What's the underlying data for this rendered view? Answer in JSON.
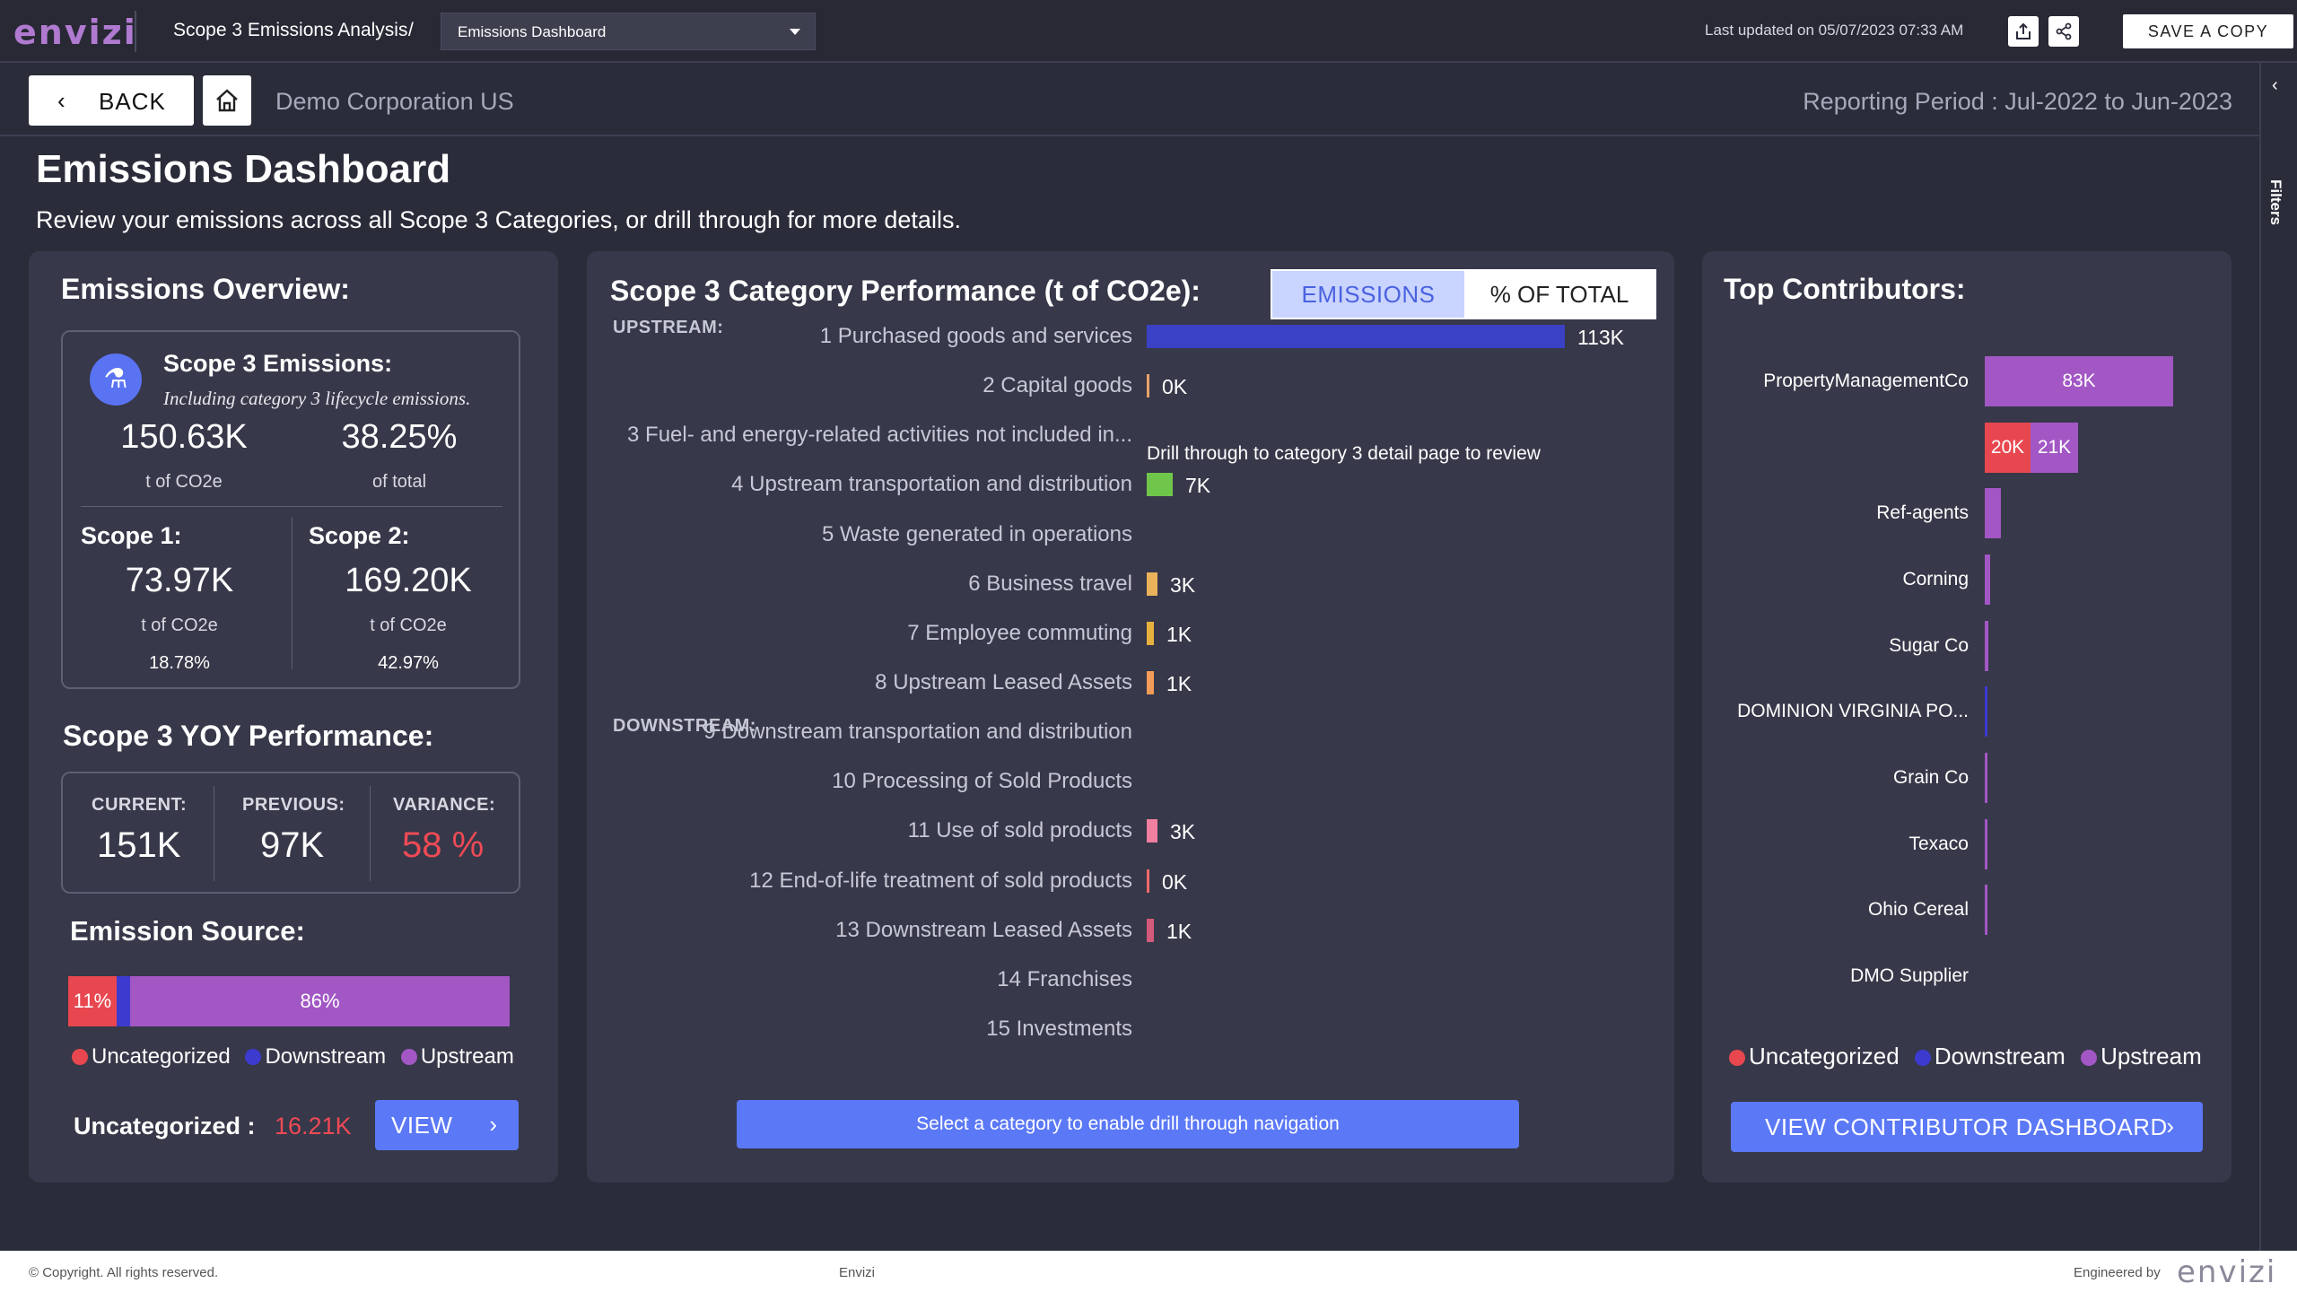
{
  "topbar": {
    "logo": "envizi",
    "breadcrumb_title": "Scope 3 Emissions Analysis",
    "breadcrumb_sep": "/",
    "dashboard_select": "Emissions Dashboard",
    "last_updated": "Last updated on 05/07/2023 07:33 AM",
    "export_icon": "export-icon",
    "share_icon": "share-icon",
    "save_copy": "SAVE A COPY"
  },
  "subbar": {
    "back": "BACK",
    "home_icon": "home-icon",
    "org": "Demo Corporation US",
    "period": "Reporting Period : Jul-2022 to Jun-2023"
  },
  "rail": {
    "chev": "‹",
    "filters": "Filters"
  },
  "page": {
    "title": "Emissions Dashboard",
    "subtitle": "Review your emissions across all Scope 3 Categories, or drill through for more details."
  },
  "overview": {
    "title": "Emissions Overview:",
    "scope3_title": "Scope 3 Emissions:",
    "scope3_note": "Including category 3 lifecycle emissions.",
    "scope3_value": "150.63K",
    "scope3_unit": "t of CO2e",
    "scope3_pct": "38.25%",
    "scope3_pct_lbl": "of total",
    "scope1_lbl": "Scope 1:",
    "scope1_value": "73.97K",
    "scope1_unit": "t of CO2e",
    "scope1_pct": "18.78%",
    "scope2_lbl": "Scope 2:",
    "scope2_value": "169.20K",
    "scope2_unit": "t of CO2e",
    "scope2_pct": "42.97%"
  },
  "yoy": {
    "title": "Scope 3 YOY Performance:",
    "current_lbl": "CURRENT:",
    "current": "151K",
    "previous_lbl": "PREVIOUS:",
    "previous": "97K",
    "variance_lbl": "VARIANCE:",
    "variance": "58 %"
  },
  "source": {
    "title": "Emission Source:",
    "segments": [
      {
        "label": "11%",
        "pct": 11,
        "color": "#e8474f"
      },
      {
        "label": "",
        "pct": 3,
        "color": "#3d3ad0"
      },
      {
        "label": "86%",
        "pct": 86,
        "color": "#a257c4"
      }
    ],
    "legend": [
      "Uncategorized",
      "Downstream",
      "Upstream"
    ],
    "legend_colors": [
      "#e8474f",
      "#3d3ad0",
      "#a257c4"
    ],
    "uncategorized_lbl": "Uncategorized :",
    "uncategorized_val": "16.21K",
    "view": "VIEW"
  },
  "category": {
    "title": "Scope 3 Category Performance (t of CO2e):",
    "toggle_emissions": "EMISSIONS",
    "toggle_pct": "% OF TOTAL",
    "upstream_lbl": "UPSTREAM:",
    "downstream_lbl": "DOWNSTREAM:",
    "drill_note": "Drill through to category 3 detail page to review",
    "drill_button": "Select a category to enable drill through navigation"
  },
  "chart_data": {
    "type": "bar",
    "categories": [
      "1 Purchased goods and services",
      "2 Capital goods",
      "3 Fuel- and energy-related activities not included in...",
      "4 Upstream transportation and distribution",
      "5 Waste generated in operations",
      "6 Business travel",
      "7 Employee commuting",
      "8 Upstream Leased Assets",
      "9 Downstream transportation and distribution",
      "10 Processing of Sold Products",
      "11 Use of sold products",
      "12 End-of-life treatment of sold products",
      "13 Downstream Leased Assets",
      "14 Franchises",
      "15 Investments"
    ],
    "values": [
      113,
      0,
      null,
      7,
      null,
      3,
      1,
      1,
      null,
      null,
      3,
      0,
      1,
      null,
      null
    ],
    "labels": [
      "113K",
      "0K",
      "",
      "7K",
      "",
      "3K",
      "1K",
      "1K",
      "",
      "",
      "3K",
      "0K",
      "1K",
      "",
      ""
    ],
    "colors": [
      "#3b41c5",
      "#e8a26a",
      "",
      "#6fc64a",
      "",
      "#e9b25b",
      "#e7b13f",
      "#f39b59",
      "",
      "",
      "#f07fa0",
      "#ef6a6a",
      "#d35a7a",
      "",
      ""
    ],
    "xlim": [
      0,
      113
    ]
  },
  "contributors": {
    "title": "Top Contributors:",
    "rows": [
      {
        "name": "PropertyManagementCo",
        "segments": [
          {
            "label": "83K",
            "value": 83,
            "color": "#a257c4"
          }
        ]
      },
      {
        "name": "",
        "segments": [
          {
            "label": "20K",
            "value": 20,
            "color": "#e8474f"
          },
          {
            "label": "21K",
            "value": 21,
            "color": "#a257c4"
          }
        ]
      },
      {
        "name": "Ref-agents",
        "segments": [
          {
            "label": "",
            "value": 7,
            "color": "#a257c4"
          }
        ]
      },
      {
        "name": "Corning",
        "segments": [
          {
            "label": "",
            "value": 2.5,
            "color": "#a257c4"
          }
        ]
      },
      {
        "name": "Sugar Co",
        "segments": [
          {
            "label": "",
            "value": 1.5,
            "color": "#a257c4"
          }
        ]
      },
      {
        "name": "DOMINION VIRGINIA PO...",
        "segments": [
          {
            "label": "",
            "value": 1.2,
            "color": "#3d3ad0"
          }
        ]
      },
      {
        "name": "Grain Co",
        "segments": [
          {
            "label": "",
            "value": 1.2,
            "color": "#a257c4"
          }
        ]
      },
      {
        "name": "Texaco",
        "segments": [
          {
            "label": "",
            "value": 1.2,
            "color": "#a257c4"
          }
        ]
      },
      {
        "name": "Ohio Cereal",
        "segments": [
          {
            "label": "",
            "value": 1.2,
            "color": "#a257c4"
          }
        ]
      },
      {
        "name": "DMO Supplier",
        "segments": []
      }
    ],
    "legend": [
      "Uncategorized",
      "Downstream",
      "Upstream"
    ],
    "legend_colors": [
      "#e8474f",
      "#3d3ad0",
      "#a257c4"
    ],
    "button": "VIEW CONTRIBUTOR DASHBOARD"
  },
  "footer": {
    "copyright": "© Copyright. All rights reserved.",
    "center": "Envizi",
    "engineered": "Engineered by",
    "logo": "envizi"
  },
  "colors": {
    "accent": "#5b78f6",
    "negative": "#ee4a55",
    "background": "#2b2c3a",
    "panel": "#373849"
  }
}
